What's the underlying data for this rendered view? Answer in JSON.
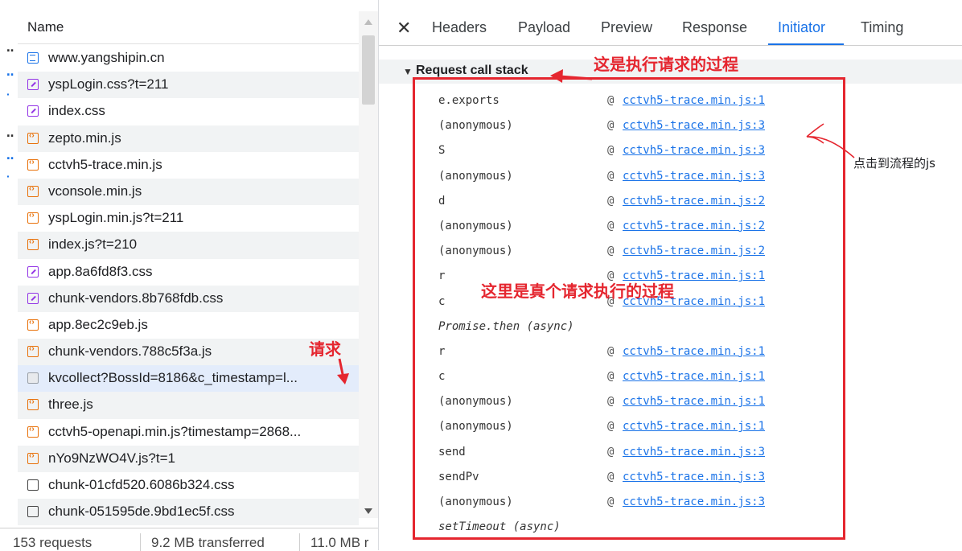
{
  "network_list": {
    "header": "Name",
    "requests": [
      {
        "name": "www.yangshipin.cn",
        "type": "doc"
      },
      {
        "name": "yspLogin.css?t=211",
        "type": "css"
      },
      {
        "name": "index.css",
        "type": "css"
      },
      {
        "name": "zepto.min.js",
        "type": "js"
      },
      {
        "name": "cctvh5-trace.min.js",
        "type": "js"
      },
      {
        "name": "vconsole.min.js",
        "type": "js"
      },
      {
        "name": "yspLogin.min.js?t=211",
        "type": "js"
      },
      {
        "name": "index.js?t=210",
        "type": "js"
      },
      {
        "name": "app.8a6fd8f3.css",
        "type": "css"
      },
      {
        "name": "chunk-vendors.8b768fdb.css",
        "type": "css"
      },
      {
        "name": "app.8ec2c9eb.js",
        "type": "js"
      },
      {
        "name": "chunk-vendors.788c5f3a.js",
        "type": "js"
      },
      {
        "name": "kvcollect?BossId=8186&c_timestamp=l...",
        "type": "xhr"
      },
      {
        "name": "three.js",
        "type": "js"
      },
      {
        "name": "cctvh5-openapi.min.js?timestamp=2868...",
        "type": "js"
      },
      {
        "name": "nYo9NzWO4V.js?t=1",
        "type": "js"
      },
      {
        "name": "chunk-01cfd520.6086b324.css",
        "type": "other"
      },
      {
        "name": "chunk-051595de.9bd1ec5f.css",
        "type": "other"
      }
    ],
    "selected_index": 12
  },
  "status_bar": {
    "requests": "153 requests",
    "transferred": "9.2 MB transferred",
    "resources": "11.0 MB r"
  },
  "detail_tabs": {
    "close_icon": "close-icon",
    "tabs": [
      "Headers",
      "Payload",
      "Preview",
      "Response",
      "Initiator",
      "Timing"
    ],
    "active": "Initiator"
  },
  "call_stack": {
    "title": "Request call stack",
    "frames": [
      {
        "fn": "e.exports",
        "link": "cctvh5-trace.min.js:1"
      },
      {
        "fn": "(anonymous)",
        "link": "cctvh5-trace.min.js:3"
      },
      {
        "fn": "S",
        "link": "cctvh5-trace.min.js:3"
      },
      {
        "fn": "(anonymous)",
        "link": "cctvh5-trace.min.js:3"
      },
      {
        "fn": "d",
        "link": "cctvh5-trace.min.js:2"
      },
      {
        "fn": "(anonymous)",
        "link": "cctvh5-trace.min.js:2"
      },
      {
        "fn": "(anonymous)",
        "link": "cctvh5-trace.min.js:2"
      },
      {
        "fn": "r",
        "link": "cctvh5-trace.min.js:1"
      },
      {
        "fn": "c",
        "link": "cctvh5-trace.min.js:1"
      },
      {
        "fn": "Promise.then (async)",
        "link": "",
        "async": true
      },
      {
        "fn": "r",
        "link": "cctvh5-trace.min.js:1"
      },
      {
        "fn": "c",
        "link": "cctvh5-trace.min.js:1"
      },
      {
        "fn": "(anonymous)",
        "link": "cctvh5-trace.min.js:1"
      },
      {
        "fn": "(anonymous)",
        "link": "cctvh5-trace.min.js:1"
      },
      {
        "fn": "send",
        "link": "cctvh5-trace.min.js:3"
      },
      {
        "fn": "sendPv",
        "link": "cctvh5-trace.min.js:3"
      },
      {
        "fn": "(anonymous)",
        "link": "cctvh5-trace.min.js:3"
      },
      {
        "fn": "setTimeout (async)",
        "link": "",
        "async": true
      }
    ],
    "at_symbol": "@"
  },
  "annotations": {
    "top": "这是执行请求的过程",
    "middle": "这里是真个请求执行的过程",
    "request": "请求",
    "note": "点击到流程的js"
  },
  "colors": {
    "accent": "#1a73e8",
    "annotation_red": "#e5262f",
    "selected_row": "#e3ecfb"
  }
}
